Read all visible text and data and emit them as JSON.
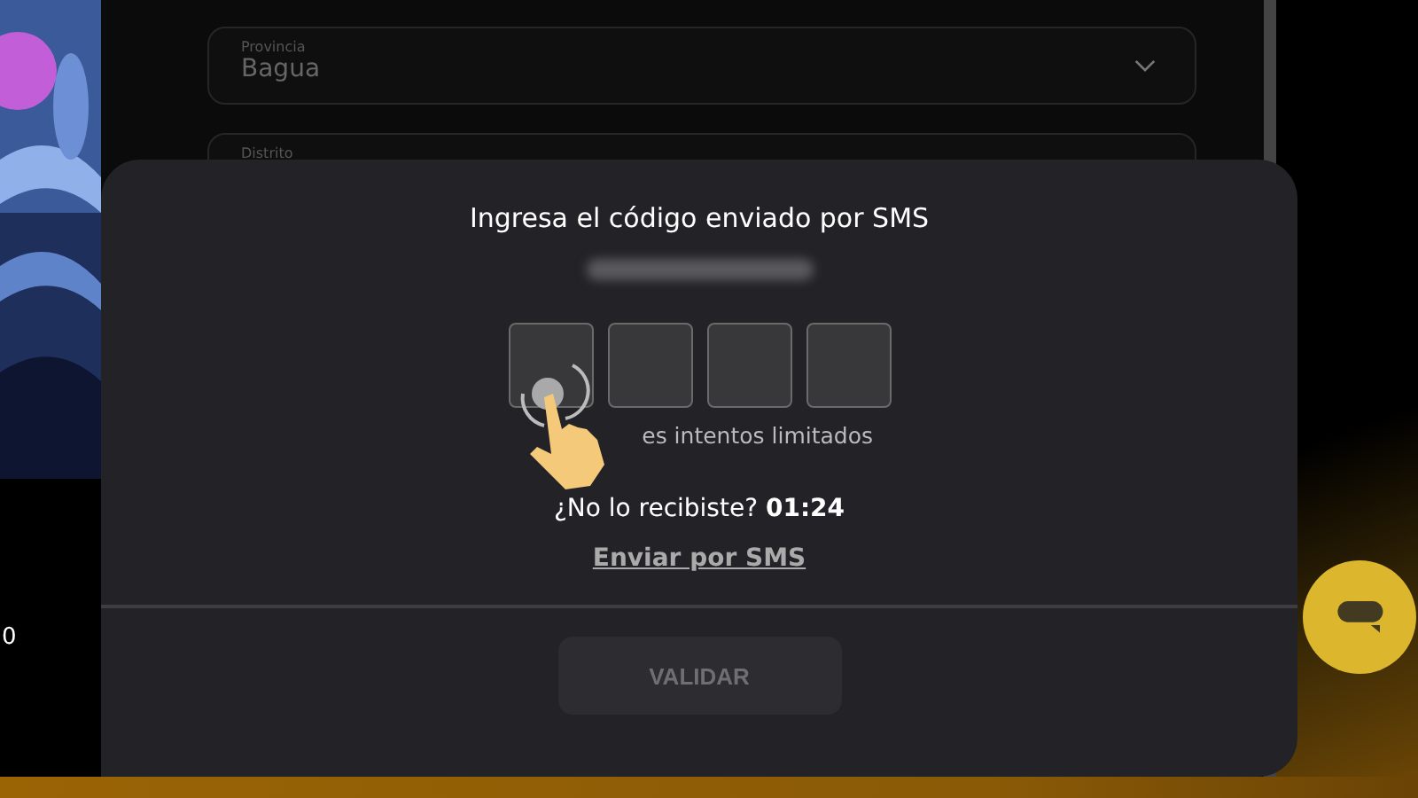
{
  "left_panel": {
    "text": "0"
  },
  "form": {
    "fields": [
      {
        "label": "Provincia",
        "value": "Bagua",
        "kind": "select"
      },
      {
        "label": "Distrito",
        "kind": "text"
      }
    ]
  },
  "modal": {
    "title": "Ingresa el código enviado por SMS",
    "code_boxes": [
      {
        "filled": false
      },
      {
        "filled": false
      },
      {
        "filled": false
      },
      {
        "filled": false
      }
    ],
    "hint": "es intentos limitados",
    "resend_prompt": "¿No lo recibiste?",
    "countdown": "01:24",
    "resend_link": "Enviar por SMS",
    "validate_button": "VALIDAR"
  }
}
